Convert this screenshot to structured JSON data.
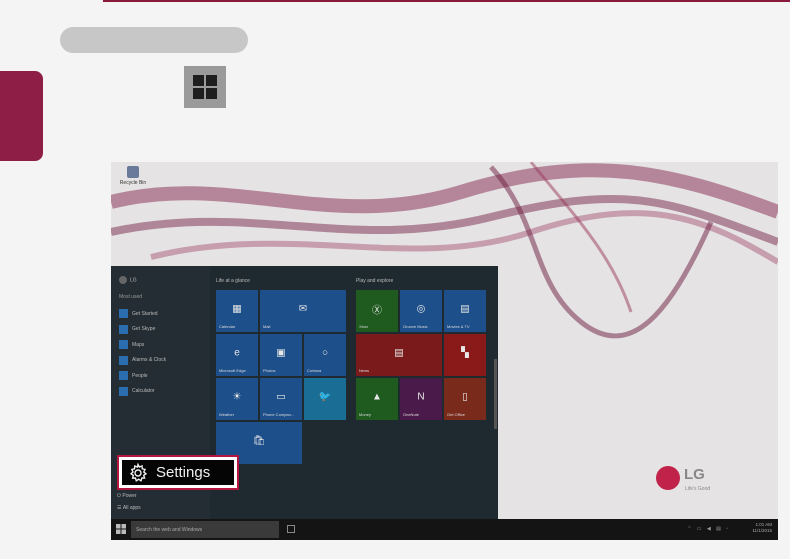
{
  "desktop": {
    "icon_label": "Recycle Bin"
  },
  "start_menu": {
    "user": "LG",
    "most_used_label": "Most used",
    "apps": [
      {
        "label": "Get Started",
        "color": "#2a6eb0"
      },
      {
        "label": "Get Skype",
        "color": "#2a6eb0"
      },
      {
        "label": "Maps",
        "color": "#2a6eb0"
      },
      {
        "label": "Alarms & Clock",
        "color": "#2a6eb0"
      },
      {
        "label": "People",
        "color": "#2a6eb0"
      },
      {
        "label": "Calculator",
        "color": "#2a6eb0"
      }
    ],
    "group_life": "Life at a glance",
    "group_play": "Play and explore",
    "tiles": [
      {
        "name": "tile-calendar",
        "label": "Calendar",
        "glyph": "▦",
        "color": "#1d4f8a",
        "col": 0,
        "row": 0,
        "w": 1,
        "h": 1,
        "grp": "life"
      },
      {
        "name": "tile-mail",
        "label": "Mail",
        "glyph": "✉",
        "color": "#1d4f8a",
        "col": 1,
        "row": 0,
        "w": 2,
        "h": 1,
        "grp": "life"
      },
      {
        "name": "tile-edge",
        "label": "Microsoft Edge",
        "glyph": "e",
        "color": "#1d4f8a",
        "col": 0,
        "row": 1,
        "w": 1,
        "h": 1,
        "grp": "life"
      },
      {
        "name": "tile-photos",
        "label": "Photos",
        "glyph": "▣",
        "color": "#1d4f8a",
        "col": 1,
        "row": 1,
        "w": 1,
        "h": 1,
        "grp": "life"
      },
      {
        "name": "tile-cortana",
        "label": "Cortana",
        "glyph": "○",
        "color": "#1d4f8a",
        "col": 2,
        "row": 1,
        "w": 1,
        "h": 1,
        "grp": "life"
      },
      {
        "name": "tile-weather",
        "label": "Weather",
        "glyph": "☀",
        "color": "#1d4f8a",
        "col": 0,
        "row": 2,
        "w": 1,
        "h": 1,
        "grp": "life"
      },
      {
        "name": "tile-phone",
        "label": "Phone Compan...",
        "glyph": "▭",
        "color": "#1d4f8a",
        "col": 1,
        "row": 2,
        "w": 1,
        "h": 1,
        "grp": "life"
      },
      {
        "name": "tile-twitter",
        "label": "",
        "glyph": "🐦",
        "color": "#1a6e96",
        "col": 2,
        "row": 2,
        "w": 1,
        "h": 1,
        "grp": "life"
      },
      {
        "name": "tile-store",
        "label": "",
        "glyph": "🛍",
        "color": "#1d4f8a",
        "col": 0,
        "row": 3,
        "w": 2,
        "h": 1,
        "grp": "life"
      },
      {
        "name": "tile-xbox",
        "label": "Xbox",
        "glyph": "Ⓧ",
        "color": "#1f5a1f",
        "col": 0,
        "row": 0,
        "w": 1,
        "h": 1,
        "grp": "play"
      },
      {
        "name": "tile-groove",
        "label": "Groove Music",
        "glyph": "◎",
        "color": "#1d4f8a",
        "col": 1,
        "row": 0,
        "w": 1,
        "h": 1,
        "grp": "play"
      },
      {
        "name": "tile-movies",
        "label": "Movies & TV",
        "glyph": "▤",
        "color": "#1d4f8a",
        "col": 2,
        "row": 0,
        "w": 1,
        "h": 1,
        "grp": "play"
      },
      {
        "name": "tile-news",
        "label": "News",
        "glyph": "▤",
        "color": "#7a1a1a",
        "col": 0,
        "row": 1,
        "w": 2,
        "h": 1,
        "grp": "play"
      },
      {
        "name": "tile-flipboard",
        "label": "",
        "glyph": "▚",
        "color": "#8a1a1a",
        "col": 2,
        "row": 1,
        "w": 1,
        "h": 1,
        "grp": "play"
      },
      {
        "name": "tile-money",
        "label": "Money",
        "glyph": "▲",
        "color": "#1f5a1f",
        "col": 0,
        "row": 2,
        "w": 1,
        "h": 1,
        "grp": "play"
      },
      {
        "name": "tile-onenote",
        "label": "OneNote",
        "glyph": "N",
        "color": "#4a1a4a",
        "col": 1,
        "row": 2,
        "w": 1,
        "h": 1,
        "grp": "play"
      },
      {
        "name": "tile-office",
        "label": "Get Office",
        "glyph": "▯",
        "color": "#7a2a1a",
        "col": 2,
        "row": 2,
        "w": 1,
        "h": 1,
        "grp": "play"
      }
    ],
    "power_label": "Power",
    "all_apps_label": "All apps"
  },
  "taskbar": {
    "search_placeholder": "Search the web and Windows",
    "time": "1:01 AM",
    "date": "11/1/2015"
  },
  "brand": {
    "logo_text": "LG",
    "tagline": "Life's Good",
    "accent": "#b5163f"
  },
  "callout": {
    "settings_label": "Settings"
  }
}
